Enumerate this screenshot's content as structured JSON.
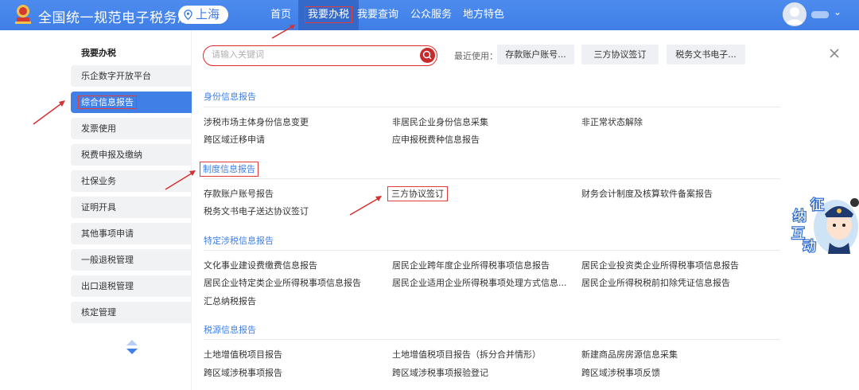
{
  "header": {
    "brand": "全国统一规范电子税务局",
    "region": "上海",
    "nav": [
      {
        "label": "首页"
      },
      {
        "label": "我要办税"
      },
      {
        "label": "我要查询"
      },
      {
        "label": "公众服务"
      },
      {
        "label": "地方特色"
      }
    ]
  },
  "sidebar": {
    "title": "我要办税",
    "items": [
      {
        "label": "乐企数字开放平台"
      },
      {
        "label": "综合信息报告"
      },
      {
        "label": "发票使用"
      },
      {
        "label": "税费申报及缴纳"
      },
      {
        "label": "社保业务"
      },
      {
        "label": "证明开具"
      },
      {
        "label": "其他事项申请"
      },
      {
        "label": "一般退税管理"
      },
      {
        "label": "出口退税管理"
      },
      {
        "label": "核定管理"
      }
    ]
  },
  "search": {
    "placeholder": "请输入关键词",
    "recent_label": "最近使用：",
    "recent": [
      {
        "label": "存款账户账号..."
      },
      {
        "label": "三方协议签订"
      },
      {
        "label": "税务文书电子..."
      }
    ]
  },
  "sections": [
    {
      "title": "身份信息报告",
      "links": [
        "涉税市场主体身份信息变更",
        "非居民企业身份信息采集",
        "非正常状态解除",
        "跨区域迁移申请",
        "应申报税费种信息报告"
      ]
    },
    {
      "title": "制度信息报告",
      "links": [
        "存款账户账号报告",
        "三方协议签订",
        "财务会计制度及核算软件备案报告",
        "税务文书电子送达协议签订"
      ]
    },
    {
      "title": "特定涉税信息报告",
      "links": [
        "文化事业建设费缴费信息报告",
        "居民企业跨年度企业所得税事项信息报告",
        "居民企业投资类企业所得税事项信息报告",
        "居民企业特定类企业所得税事项信息报告",
        "居民企业适用企业所得税事项处理方式信息...",
        "居民企业所得税税前扣除凭证信息报告",
        "汇总纳税报告"
      ]
    },
    {
      "title": "税源信息报告",
      "links": [
        "土地增值税项目报告",
        "土地增值税项目报告（拆分合并情形）",
        "新建商品房房源信息采集",
        "跨区域涉税事项报告",
        "跨区域涉税事项报验登记",
        "跨区域涉税事项反馈"
      ]
    }
  ],
  "mascot": {
    "chars": [
      "征",
      "纳",
      "互",
      "动"
    ]
  },
  "colors": {
    "primary": "#3f7fe6",
    "highlight": "#e43b3b",
    "search_btn": "#c62a2a"
  }
}
